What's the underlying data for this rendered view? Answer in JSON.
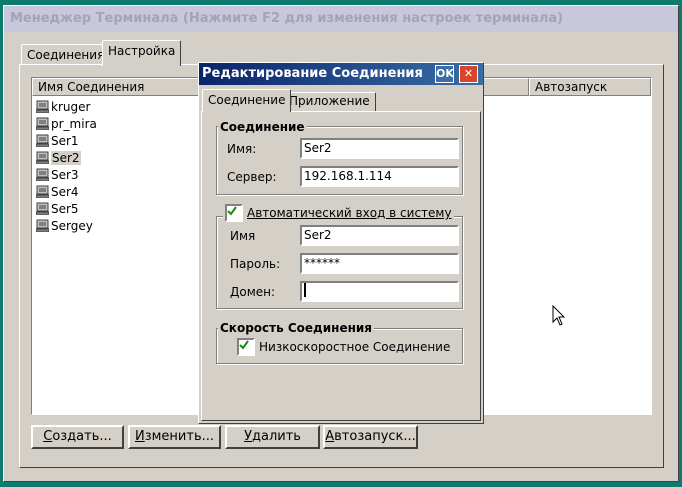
{
  "window": {
    "title": "Менеджер Терминала (Нажмите F2 для изменения настроек терминала)"
  },
  "main_tabs": [
    {
      "label": "Соединения"
    },
    {
      "label": "Настройка"
    }
  ],
  "list": {
    "col_name": "Имя Соединения",
    "col_autostart": "Автозапуск",
    "items": [
      {
        "label": "kruger"
      },
      {
        "label": "pr_mira"
      },
      {
        "label": "Ser1"
      },
      {
        "label": "Ser2",
        "selected": true
      },
      {
        "label": "Ser3"
      },
      {
        "label": "Ser4"
      },
      {
        "label": "Ser5"
      },
      {
        "label": "Sergey"
      }
    ]
  },
  "buttons": {
    "create": {
      "u": "С",
      "rest": "оздать..."
    },
    "edit": {
      "u": "И",
      "rest": "зменить..."
    },
    "delete": {
      "u": "У",
      "rest": "далить"
    },
    "autostart": {
      "u": "А",
      "rest": "втозапуск..."
    }
  },
  "dialog": {
    "title": "Редактирование Соединения",
    "ok_label": "OK",
    "close_label": "✕",
    "tabs": [
      {
        "label": "Соединение"
      },
      {
        "label": "Приложение"
      }
    ],
    "connection_group": {
      "title": "Соединение",
      "name_label": "Имя:",
      "name_value": "Ser2",
      "server_label": "Сервер:",
      "server_value": "192.168.1.114"
    },
    "autologin_group": {
      "checkbox_label": "Автоматический вход в систему",
      "checked": true,
      "user_label": "Имя",
      "user_value": "Ser2",
      "password_label": "Пароль:",
      "password_value": "******",
      "domain_label": "Домен:",
      "domain_value": ""
    },
    "speed_group": {
      "title": "Скорость Соединения",
      "checkbox_label": "Низкоскоростное Соединение",
      "checked": true
    }
  },
  "colors": {
    "desktop": "#0c7a6c",
    "titlebar_active": "#0a246a",
    "ok_button": "#3a6ea5",
    "close_button": "#d9442a"
  }
}
